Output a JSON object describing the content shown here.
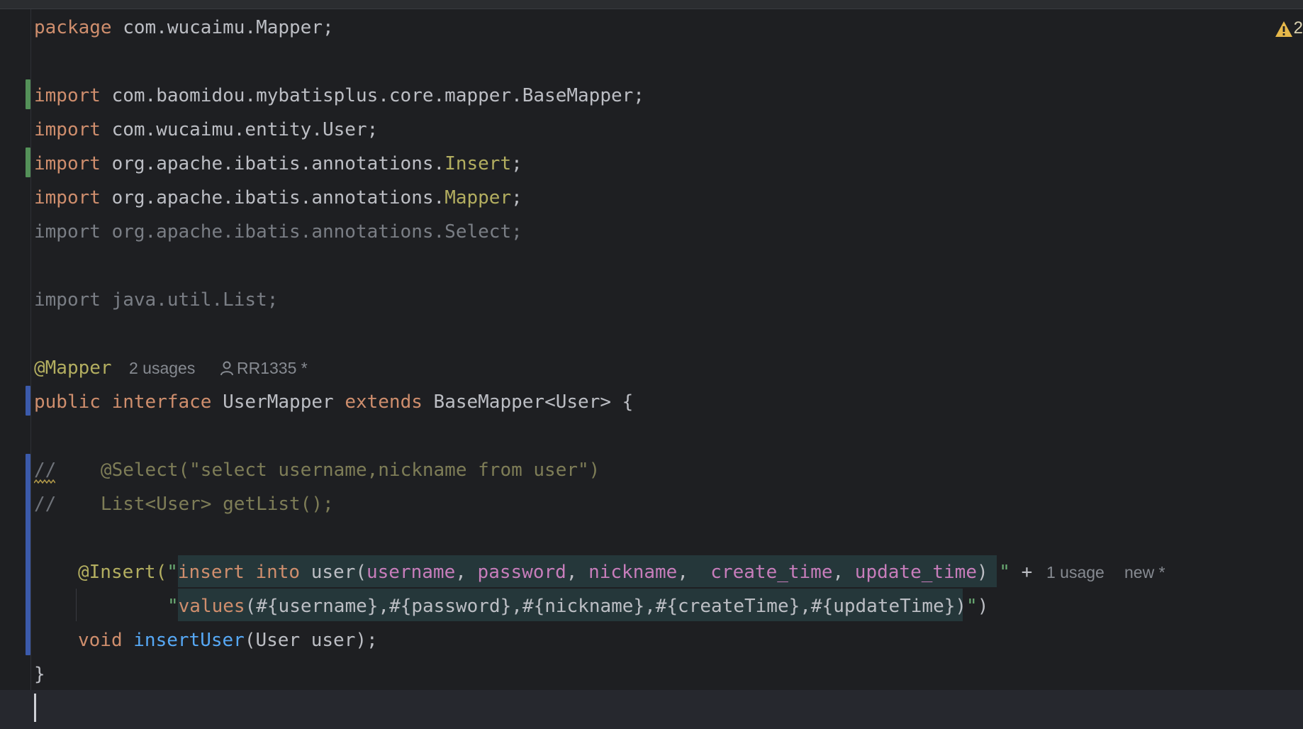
{
  "editor": {
    "language": "java",
    "warning_count": "2",
    "lines": {
      "l1": {
        "kw": "package",
        "rest": " com.wucaimu.Mapper;"
      },
      "l3": {
        "kw": "import",
        "rest": " com.baomidou.mybatisplus.core.mapper.BaseMapper;"
      },
      "l4": {
        "kw": "import",
        "rest": " com.wucaimu.entity.User;"
      },
      "l5": {
        "kw": "import",
        "pre": " org.apache.ibatis.annotations.",
        "cls": "Insert",
        "end": ";"
      },
      "l6": {
        "kw": "import",
        "pre": " org.apache.ibatis.annotations.",
        "cls": "Mapper",
        "end": ";"
      },
      "l7": {
        "text": "import org.apache.ibatis.annotations.Select;"
      },
      "l9": {
        "text": "import java.util.List;"
      },
      "l11": {
        "ann": "@Mapper"
      },
      "l12": {
        "kw1": "public",
        "kw2": "interface",
        "name": " UserMapper ",
        "kw3": "extends",
        "rest": " BaseMapper<User> {"
      },
      "l14": {
        "slashes": "//",
        "body": "    @Select(\"select username,nickname from user\")"
      },
      "l15": {
        "slashes": "//",
        "body": "    List<User> getList();"
      },
      "l17": {
        "ann": "@Insert(",
        "q": "\"",
        "sql1": "insert into",
        "sql2": " user(",
        "c1": "username",
        "sep1": ", ",
        "c2": "password",
        "sep2": ", ",
        "c3": "nickname",
        "sep3": ",  ",
        "c4": "create_time",
        "sep4": ", ",
        "c5": "update_time",
        "sql3": ") ",
        "qend": "\"",
        "plus": " +"
      },
      "l18": {
        "q": "\"",
        "kwv": "values",
        "vals": "(#{username},#{password},#{nickname},#{createTime},#{updateTime})",
        "qend": "\"",
        "end": ")"
      },
      "l19": {
        "kw": "void",
        "fn": "insertUser",
        "rest": "(User user);"
      },
      "l20": {
        "text": "}"
      }
    },
    "inlays": {
      "mapper_usages": "2 usages",
      "mapper_author": "RR1335 *",
      "insert_usages": "1 usage",
      "insert_author": "new *"
    }
  }
}
